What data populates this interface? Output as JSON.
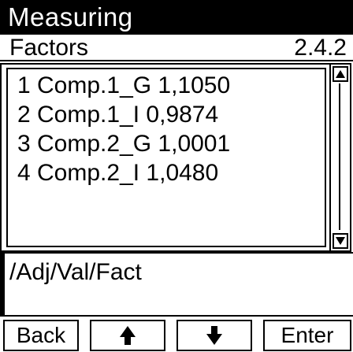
{
  "header": {
    "title": "Measuring"
  },
  "subheader": {
    "label": "Factors",
    "page": "2.4.2"
  },
  "list": {
    "rows": [
      "1 Comp.1_G 1,1050",
      "2 Comp.1_I 0,9874",
      "3 Comp.2_G 1,0001",
      "4 Comp.2_I 1,0480"
    ]
  },
  "path": "/Adj/Val/Fact",
  "softkeys": {
    "back": "Back",
    "up_icon": "arrow-up-icon",
    "down_icon": "arrow-down-icon",
    "enter": "Enter"
  },
  "colors": {
    "foreground": "#000000",
    "background": "#ffffff"
  }
}
